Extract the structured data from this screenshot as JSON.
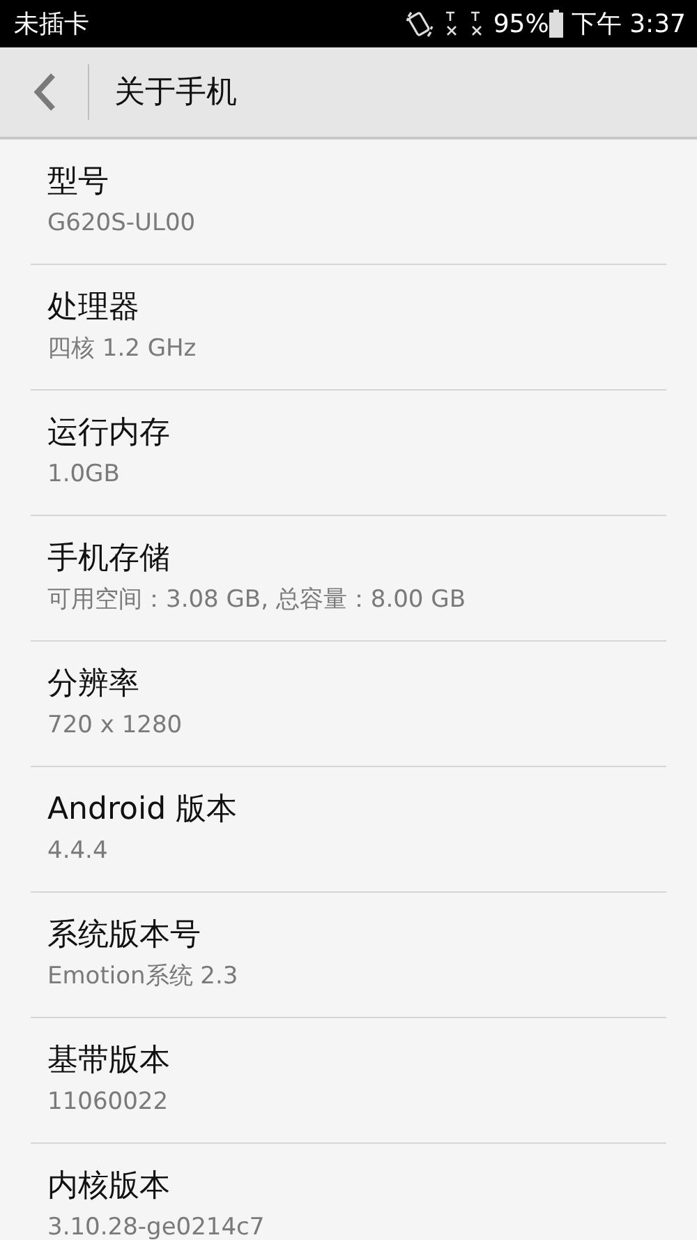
{
  "status_bar": {
    "carrier": "未插卡",
    "battery": "95%",
    "time": "下午 3:37"
  },
  "header": {
    "title": "关于手机"
  },
  "items": [
    {
      "title": "型号",
      "value": "G620S-UL00"
    },
    {
      "title": "处理器",
      "value": "四核 1.2 GHz"
    },
    {
      "title": "运行内存",
      "value": "1.0GB"
    },
    {
      "title": "手机存储",
      "value": "可用空间：3.08 GB, 总容量：8.00 GB"
    },
    {
      "title": "分辨率",
      "value": "720 x 1280"
    },
    {
      "title": "Android 版本",
      "value": "4.4.4"
    },
    {
      "title": "系统版本号",
      "value": "Emotion系统 2.3"
    },
    {
      "title": "基带版本",
      "value": "11060022"
    },
    {
      "title": "内核版本",
      "value": "3.10.28-ge0214c7"
    }
  ]
}
